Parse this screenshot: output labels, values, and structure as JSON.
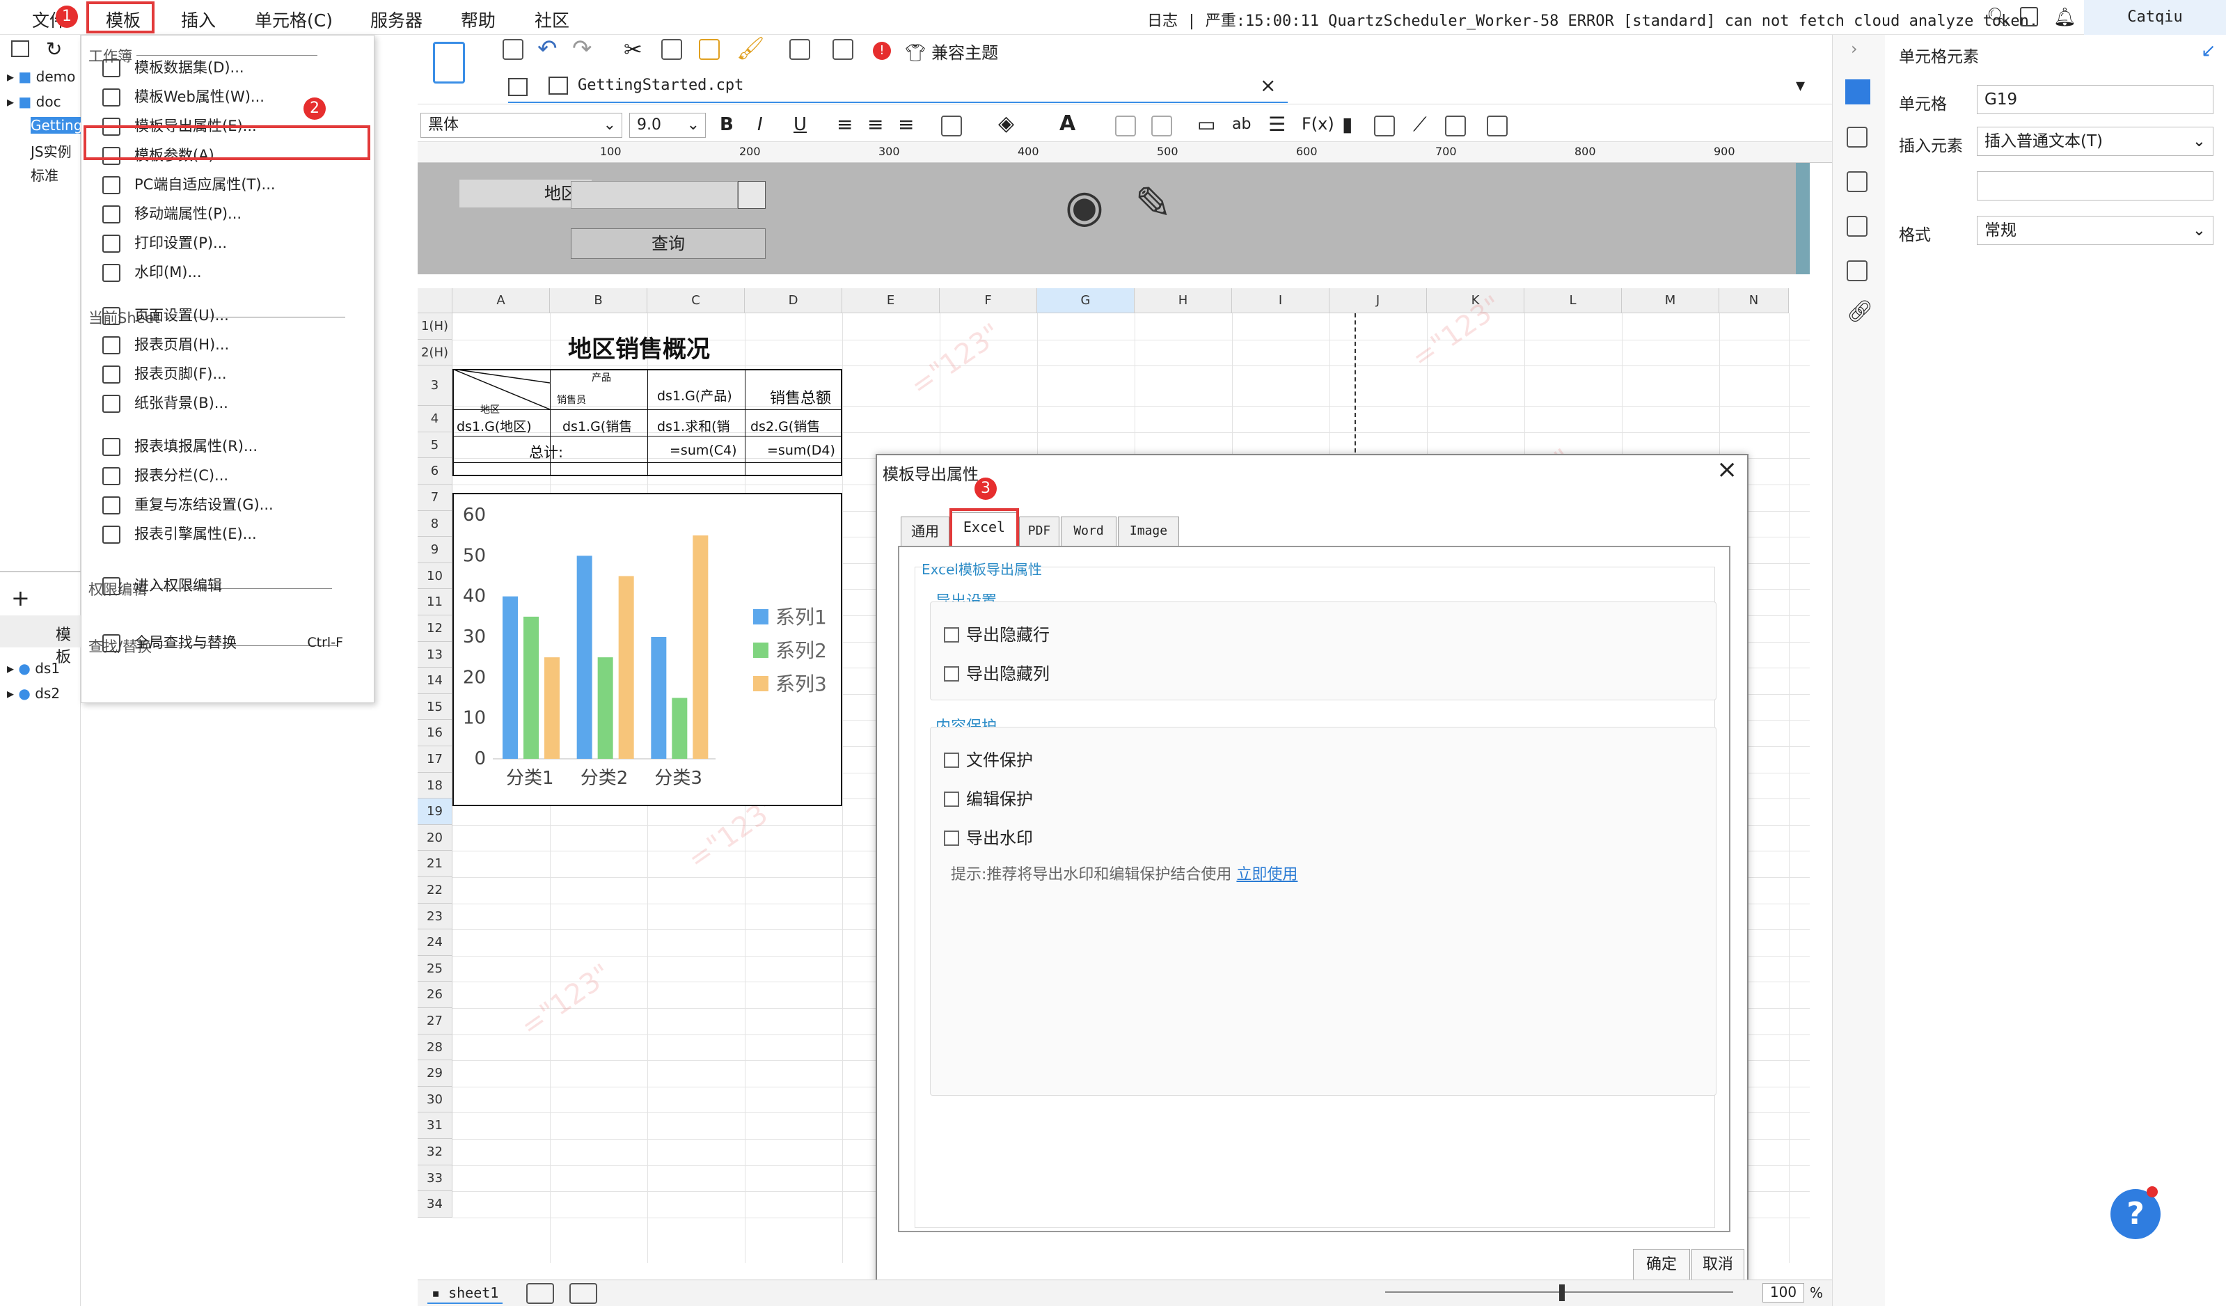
{
  "menu": {
    "items": [
      "文件",
      "模板",
      "插入",
      "单元格(C)",
      "服务器",
      "帮助",
      "社区"
    ],
    "status": "日志 | 严重:15:00:11 QuartzScheduler_Worker-58 ERROR [standard] can not fetch cloud analyze token.",
    "user": "Catqiu"
  },
  "badges": [
    "1",
    "2",
    "3"
  ],
  "left_tree": {
    "items": [
      "demo",
      "doc",
      "GettingStarted",
      "JS实例",
      "标准"
    ],
    "datasets": [
      "ds1",
      "ds2"
    ],
    "tab_label": "模板"
  },
  "dropdown": {
    "sections": {
      "workbook": "工作簿",
      "sheet": "当前Sheet",
      "permission": "权限编辑",
      "find": "查找/替换"
    },
    "items": [
      {
        "label": "模板数据集(D)...",
        "icon": "database-icon"
      },
      {
        "label": "模板Web属性(W)...",
        "icon": "globe-icon"
      },
      {
        "label": "模板导出属性(E)...",
        "icon": "export-icon"
      },
      {
        "label": "模板参数(A)...",
        "icon": "param-icon"
      },
      {
        "label": "PC端自适应属性(T)...",
        "icon": "pc-adapt-icon"
      },
      {
        "label": "移动端属性(P)...",
        "icon": "mobile-icon"
      },
      {
        "label": "打印设置(P)...",
        "icon": "printer-icon"
      },
      {
        "label": "水印(M)...",
        "icon": "watermark-icon"
      },
      {
        "label": "页面设置(U)...",
        "icon": "page-setup-icon"
      },
      {
        "label": "报表页眉(H)...",
        "icon": "header-icon"
      },
      {
        "label": "报表页脚(F)...",
        "icon": "footer-icon"
      },
      {
        "label": "纸张背景(B)...",
        "icon": "paper-bg-icon"
      },
      {
        "label": "报表填报属性(R)...",
        "icon": "fill-attr-icon"
      },
      {
        "label": "报表分栏(C)...",
        "icon": "columns-icon"
      },
      {
        "label": "重复与冻结设置(G)...",
        "icon": "freeze-icon"
      },
      {
        "label": "报表引擎属性(E)...",
        "icon": "engine-icon"
      },
      {
        "label": "进入权限编辑",
        "icon": "permission-icon"
      },
      {
        "label": "全局查找与替换",
        "icon": "search-icon",
        "shortcut": "Ctrl-F"
      }
    ]
  },
  "toolbar": {
    "theme_label": "兼容主题",
    "file_tab": "GettingStarted.cpt",
    "font": "黑体",
    "font_size": "9.0"
  },
  "ruler": [
    "100",
    "200",
    "300",
    "400",
    "500",
    "600",
    "700",
    "800",
    "900"
  ],
  "param_pane": {
    "region_label": "地区:",
    "query_button": "查询"
  },
  "sheet": {
    "columns": [
      "A",
      "B",
      "C",
      "D",
      "E",
      "F",
      "G",
      "H",
      "I",
      "J",
      "K",
      "L",
      "M",
      "N"
    ],
    "rows": [
      "1(H)",
      "2(H)",
      "3",
      "4",
      "5",
      "6",
      "7",
      "8",
      "9",
      "10",
      "11",
      "12",
      "13",
      "14",
      "15",
      "16",
      "17",
      "18",
      "19",
      "20",
      "21",
      "22",
      "23",
      "24",
      "25",
      "26",
      "27",
      "28",
      "29",
      "30",
      "31",
      "32",
      "33",
      "34"
    ],
    "title": "地区销售概况",
    "header_product": "产品",
    "header_salesperson": "销售员",
    "header_region": "地区",
    "c3": "ds1.G(产品)",
    "d3": "销售总额",
    "a4": "ds1.G(地区)",
    "b4": "ds1.G(销售",
    "c4": "ds1.求和(销",
    "d4": "ds2.G(销售",
    "a5": "总计:",
    "c5": "=sum(C4)",
    "d5": "=sum(D4)",
    "watermark": "=\"123\"",
    "tab": "sheet1",
    "zoom": "100"
  },
  "chart_data": {
    "type": "bar",
    "categories": [
      "分类1",
      "分类2",
      "分类3"
    ],
    "series": [
      {
        "name": "系列1",
        "values": [
          40,
          50,
          30
        ],
        "color": "#5ba7ec"
      },
      {
        "name": "系列2",
        "values": [
          35,
          25,
          15
        ],
        "color": "#7fd47f"
      },
      {
        "name": "系列3",
        "values": [
          25,
          45,
          55
        ],
        "color": "#f7c57a"
      }
    ],
    "ylim": [
      0,
      60
    ],
    "yticks": [
      0,
      10,
      20,
      30,
      40,
      50,
      60
    ],
    "legend": "right"
  },
  "dialog": {
    "title": "模板导出属性",
    "tabs": [
      "通用",
      "Excel",
      "PDF",
      "Word",
      "Image"
    ],
    "section_title": "Excel模板导出属性",
    "export_group": "导出设置",
    "export_hidden_rows": "导出隐藏行",
    "export_hidden_cols": "导出隐藏列",
    "protect_group": "内容保护",
    "file_protect": "文件保护",
    "edit_protect": "编辑保护",
    "export_watermark": "导出水印",
    "hint": "提示:推荐将导出水印和编辑保护结合使用",
    "hint_link": "立即使用",
    "ok": "确定",
    "cancel": "取消"
  },
  "props": {
    "title": "单元格元素",
    "cell_label": "单元格",
    "cell_value": "G19",
    "insert_label": "插入元素",
    "insert_value": "插入普通文本(T)",
    "format_label": "格式",
    "format_value": "常规"
  },
  "colors": {
    "accent": "#2f7de0",
    "highlight_red": "#e23a3a",
    "selected_col": "#d6e9fb"
  }
}
